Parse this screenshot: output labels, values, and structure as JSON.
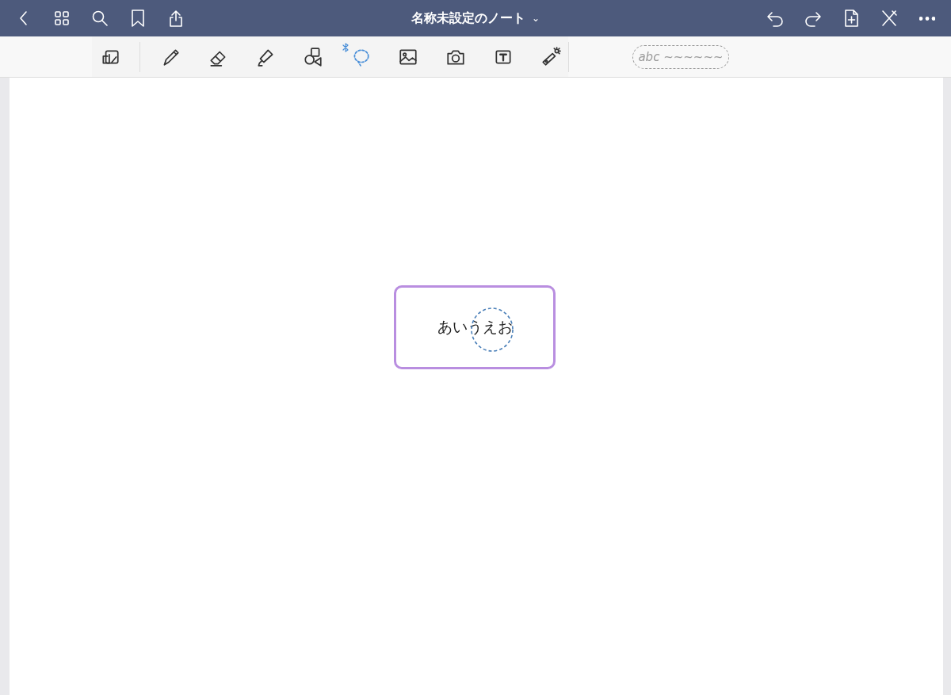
{
  "title_bar": {
    "title": "名称未設定のノート",
    "dropdown_caret": "⌄"
  },
  "tools": [
    {
      "kind": "pagemode",
      "selected": false
    },
    {
      "kind": "pen",
      "selected": false
    },
    {
      "kind": "eraser",
      "selected": false
    },
    {
      "kind": "highlighter",
      "selected": false
    },
    {
      "kind": "shapes",
      "selected": false
    },
    {
      "kind": "lasso",
      "selected": true
    },
    {
      "kind": "image",
      "selected": false
    },
    {
      "kind": "camera",
      "selected": false
    },
    {
      "kind": "text",
      "selected": false
    },
    {
      "kind": "laser",
      "selected": false
    }
  ],
  "handwriting_preview": {
    "text": "abc ~~~~~~"
  },
  "canvas": {
    "text_box": {
      "text": "あいうえお",
      "selected": true
    }
  }
}
